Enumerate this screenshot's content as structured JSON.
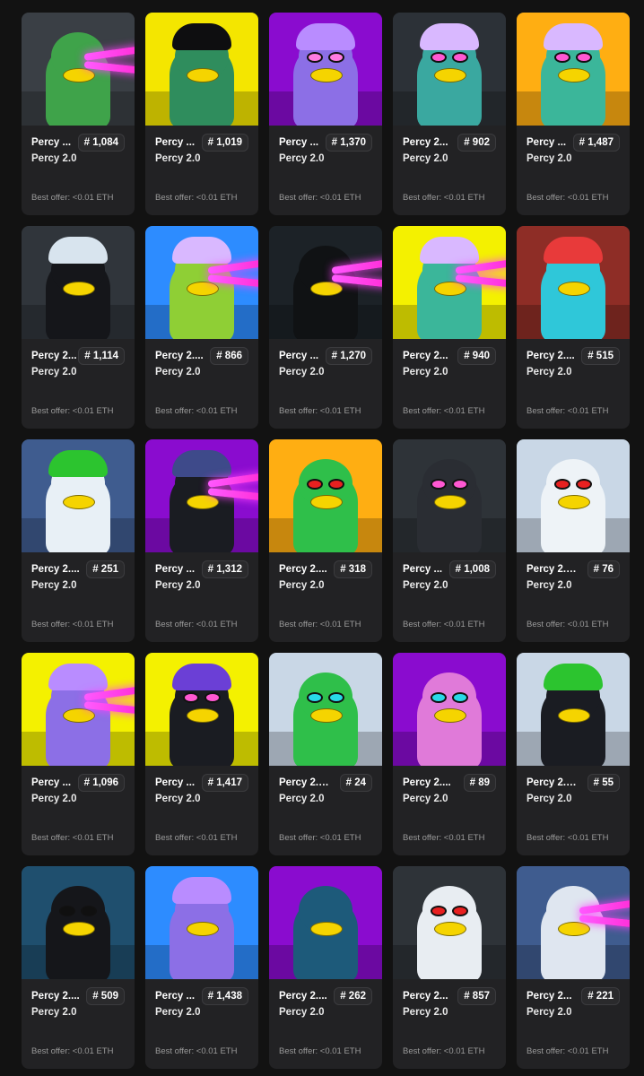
{
  "offer_prefix": "Best offer: <0.01 ETH",
  "cards": [
    {
      "name": "Percy ...",
      "number": "# 1,084",
      "collection": "Percy 2.0",
      "offer": "Best offer: <0.01 ETH",
      "bg": "#3a3f45",
      "body": "#3fa34a",
      "hat": "",
      "glasses": "",
      "laser": true
    },
    {
      "name": "Percy ...",
      "number": "# 1,019",
      "collection": "Percy 2.0",
      "offer": "Best offer: <0.01 ETH",
      "bg": "#f4e600",
      "body": "#2f8d5d",
      "hat": "#0e0e10",
      "glasses": "",
      "laser": false
    },
    {
      "name": "Percy ...",
      "number": "# 1,370",
      "collection": "Percy 2.0",
      "offer": "Best offer: <0.01 ETH",
      "bg": "#8a0ccf",
      "body": "#8c6fe6",
      "hat": "#b98cff",
      "glasses": "#ff7be0",
      "laser": false
    },
    {
      "name": "Percy 2...",
      "number": "# 902",
      "collection": "Percy 2.0",
      "offer": "Best offer: <0.01 ETH",
      "bg": "#2c3137",
      "body": "#3aa8a0",
      "hat": "#d9b8ff",
      "glasses": "#ff58d2",
      "laser": false
    },
    {
      "name": "Percy ...",
      "number": "# 1,487",
      "collection": "Percy 2.0",
      "offer": "Best offer: <0.01 ETH",
      "bg": "#ffae12",
      "body": "#3bb69a",
      "hat": "#d9b8ff",
      "glasses": "#ff58d2",
      "laser": false
    },
    {
      "name": "Percy 2...",
      "number": "# 1,114",
      "collection": "Percy 2.0",
      "offer": "Best offer: <0.01 ETH",
      "bg": "#30353b",
      "body": "#15161a",
      "hat": "#d8e4ee",
      "glasses": "",
      "laser": false
    },
    {
      "name": "Percy 2....",
      "number": "# 866",
      "collection": "Percy 2.0",
      "offer": "Best offer: <0.01 ETH",
      "bg": "#2d8cff",
      "body": "#8fcf35",
      "hat": "#d9b8ff",
      "glasses": "",
      "laser": true
    },
    {
      "name": "Percy ...",
      "number": "# 1,270",
      "collection": "Percy 2.0",
      "offer": "Best offer: <0.01 ETH",
      "bg": "#1c2227",
      "body": "#101214",
      "hat": "",
      "glasses": "",
      "laser": true
    },
    {
      "name": "Percy 2...",
      "number": "# 940",
      "collection": "Percy 2.0",
      "offer": "Best offer: <0.01 ETH",
      "bg": "#f4f100",
      "body": "#3bb69a",
      "hat": "#d9b8ff",
      "glasses": "",
      "laser": true
    },
    {
      "name": "Percy 2....",
      "number": "# 515",
      "collection": "Percy 2.0",
      "offer": "Best offer: <0.01 ETH",
      "bg": "#8e2d26",
      "body": "#2fc7d9",
      "hat": "#e83a3a",
      "glasses": "",
      "laser": false
    },
    {
      "name": "Percy 2....",
      "number": "# 251",
      "collection": "Percy 2.0",
      "offer": "Best offer: <0.01 ETH",
      "bg": "#3f5c8f",
      "body": "#e8f0f6",
      "hat": "#2cc42f",
      "glasses": "",
      "laser": false
    },
    {
      "name": "Percy ...",
      "number": "# 1,312",
      "collection": "Percy 2.0",
      "offer": "Best offer: <0.01 ETH",
      "bg": "#8a0ccf",
      "body": "#1a1c22",
      "hat": "#3e4a8a",
      "glasses": "",
      "laser": true
    },
    {
      "name": "Percy 2....",
      "number": "# 318",
      "collection": "Percy 2.0",
      "offer": "Best offer: <0.01 ETH",
      "bg": "#ffae12",
      "body": "#2fbf4a",
      "hat": "",
      "glasses": "#e82020",
      "laser": false
    },
    {
      "name": "Percy ...",
      "number": "# 1,008",
      "collection": "Percy 2.0",
      "offer": "Best offer: <0.01 ETH",
      "bg": "#2e3338",
      "body": "#2a2d33",
      "hat": "",
      "glasses": "#ff58d2",
      "laser": false
    },
    {
      "name": "Percy 2.0...",
      "number": "# 76",
      "collection": "Percy 2.0",
      "offer": "Best offer: <0.01 ETH",
      "bg": "#c9d7e6",
      "body": "#eef3f7",
      "hat": "",
      "glasses": "#e82020",
      "laser": false
    },
    {
      "name": "Percy ...",
      "number": "# 1,096",
      "collection": "Percy 2.0",
      "offer": "Best offer: <0.01 ETH",
      "bg": "#f4f100",
      "body": "#8c6fe6",
      "hat": "#b98cff",
      "glasses": "",
      "laser": true
    },
    {
      "name": "Percy ...",
      "number": "# 1,417",
      "collection": "Percy 2.0",
      "offer": "Best offer: <0.01 ETH",
      "bg": "#f4f100",
      "body": "#1a1c22",
      "hat": "#6b3fd6",
      "glasses": "#ff58d2",
      "laser": false
    },
    {
      "name": "Percy 2.0...",
      "number": "# 24",
      "collection": "Percy 2.0",
      "offer": "Best offer: <0.01 ETH",
      "bg": "#c9d7e6",
      "body": "#2fbf4a",
      "hat": "",
      "glasses": "#28d9e8",
      "laser": false
    },
    {
      "name": "Percy 2....",
      "number": "# 89",
      "collection": "Percy 2.0",
      "offer": "Best offer: <0.01 ETH",
      "bg": "#8a0ccf",
      "body": "#e07ad9",
      "hat": "",
      "glasses": "#28d9e8",
      "laser": false
    },
    {
      "name": "Percy 2.0...",
      "number": "# 55",
      "collection": "Percy 2.0",
      "offer": "Best offer: <0.01 ETH",
      "bg": "#c9d7e6",
      "body": "#1a1c22",
      "hat": "#2cc42f",
      "glasses": "",
      "laser": false
    },
    {
      "name": "Percy 2....",
      "number": "# 509",
      "collection": "Percy 2.0",
      "offer": "Best offer: <0.01 ETH",
      "bg": "#1f4f6e",
      "body": "#15161a",
      "hat": "",
      "glasses": "#101010",
      "laser": false
    },
    {
      "name": "Percy ...",
      "number": "# 1,438",
      "collection": "Percy 2.0",
      "offer": "Best offer: <0.01 ETH",
      "bg": "#2d8cff",
      "body": "#8c6fe6",
      "hat": "#b98cff",
      "glasses": "",
      "laser": false
    },
    {
      "name": "Percy 2....",
      "number": "# 262",
      "collection": "Percy 2.0",
      "offer": "Best offer: <0.01 ETH",
      "bg": "#8a0ccf",
      "body": "#1d5a7a",
      "hat": "",
      "glasses": "",
      "laser": false
    },
    {
      "name": "Percy 2...",
      "number": "# 857",
      "collection": "Percy 2.0",
      "offer": "Best offer: <0.01 ETH",
      "bg": "#2e3338",
      "body": "#e8edf2",
      "hat": "",
      "glasses": "#e82020",
      "laser": false
    },
    {
      "name": "Percy 2...",
      "number": "# 221",
      "collection": "Percy 2.0",
      "offer": "Best offer: <0.01 ETH",
      "bg": "#3f5c8f",
      "body": "#dfe6f0",
      "hat": "",
      "glasses": "",
      "laser": true
    }
  ]
}
